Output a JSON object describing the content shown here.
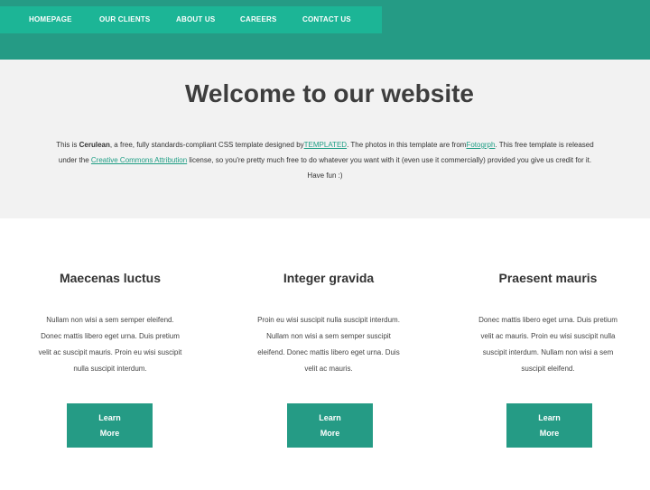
{
  "nav": {
    "items": [
      "HOMEPAGE",
      "OUR CLIENTS",
      "ABOUT US",
      "CAREERS",
      "CONTACT US"
    ]
  },
  "banner": {
    "title": "Welcome to our website",
    "line1_a": "This is ",
    "line1_brand": "Cerulean",
    "line1_b": ", a free, fully standards-compliant CSS template designed by",
    "line1_link1": "TEMPLATED",
    "line1_c": ". The photos in this template are from",
    "line1_link2": "Fotogrph",
    "line1_d": ". This free template is released",
    "line2_a": "under the ",
    "line2_link": "Creative Commons Attribution",
    "line2_b": " license, so you're pretty much free to do whatever you want with it (even use it commercially) provided you give us credit for it.",
    "line3": "Have fun :)"
  },
  "columns": [
    {
      "title": "Maecenas luctus",
      "lines": [
        "Nullam non wisi a sem semper eleifend.",
        "Donec mattis libero eget urna. Duis pretium",
        "velit ac suscipit mauris. Proin eu wisi suscipit",
        "nulla suscipit interdum."
      ],
      "button_line1": "Learn",
      "button_line2": "More"
    },
    {
      "title": "Integer gravida",
      "lines": [
        "Proin eu wisi suscipit nulla suscipit interdum.",
        "Nullam non wisi a sem semper suscipit",
        "eleifend. Donec mattis libero eget urna. Duis",
        "velit ac mauris."
      ],
      "button_line1": "Learn",
      "button_line2": "More"
    },
    {
      "title": "Praesent mauris",
      "lines": [
        "Donec mattis libero eget urna. Duis pretium",
        "velit ac mauris. Proin eu wisi suscipit nulla",
        "suscipit interdum. Nullam non wisi a sem",
        "suscipit eleifend."
      ],
      "button_line1": "Learn",
      "button_line2": "More"
    }
  ],
  "colors": {
    "header": "#259b85",
    "nav": "#1cb596",
    "banner": "#f2f2f2",
    "button": "#259b85",
    "link": "#1f9e85"
  }
}
